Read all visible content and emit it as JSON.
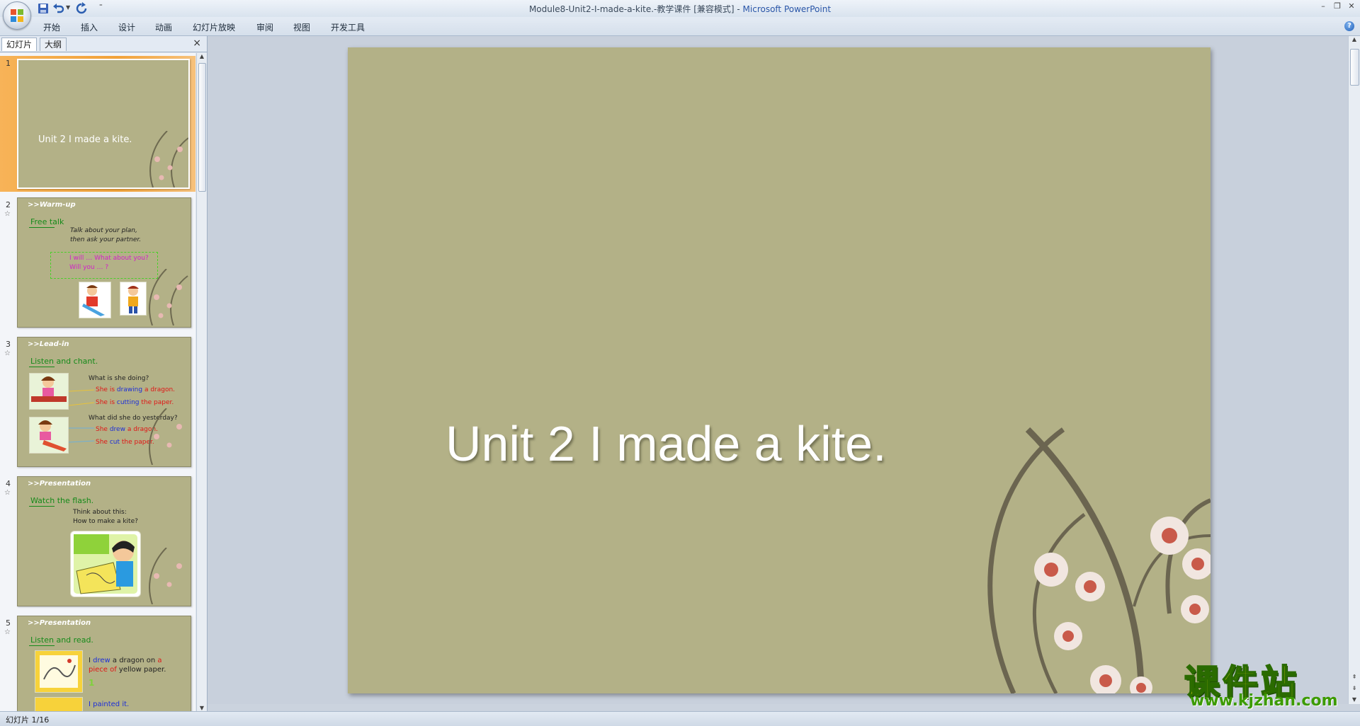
{
  "window": {
    "title_doc": "Module8-Unit2-I-made-a-kite.-教学课件 [兼容模式] - ",
    "title_app": "Microsoft PowerPoint"
  },
  "ribbon": {
    "tabs": [
      "开始",
      "插入",
      "设计",
      "动画",
      "幻灯片放映",
      "审阅",
      "视图",
      "开发工具"
    ]
  },
  "panel": {
    "tab_slides": "幻灯片",
    "tab_outline": "大纲",
    "close": "×"
  },
  "thumbnails": [
    {
      "num": "1",
      "title": "Unit 2 I made a kite."
    },
    {
      "num": "2",
      "section": ">>Warm-up",
      "heading": "Free talk",
      "text1": "Talk about your plan,",
      "text2": "then ask your partner.",
      "box1": "I will … What about you?",
      "box2": "Will you … ?"
    },
    {
      "num": "3",
      "section": ">>Lead-in",
      "heading": "Listen and chant.",
      "q1": "What is she doing?",
      "a1_pre": "She is ",
      "a1_verb": "drawing",
      "a1_post": " a dragon.",
      "a2_pre": "She is ",
      "a2_verb": "cutting",
      "a2_post": " the paper.",
      "q2": "What did she do yesterday?",
      "a3_pre": "She ",
      "a3_verb": "drew",
      "a3_post": " a dragon.",
      "a4_pre": "She ",
      "a4_verb": "cut",
      "a4_post": " the paper."
    },
    {
      "num": "4",
      "section": ">>Presentation",
      "heading": "Watch the flash.",
      "text1": "Think about this:",
      "text2": "How to make a kite?"
    },
    {
      "num": "5",
      "section": ">>Presentation",
      "heading": "Listen and read.",
      "l1_a": "I ",
      "l1_b": "drew",
      "l1_c": " a dragon on ",
      "l1_d": "a",
      "l2_a": "piece of",
      "l2_b": " yellow paper.",
      "mark": "1",
      "l3": "I painted it."
    }
  ],
  "slide": {
    "title": "Unit 2 I made a kite."
  },
  "status": {
    "text": "幻灯片 1/16"
  },
  "watermark": {
    "main": "课件站",
    "url": "www.kjzhan.com"
  }
}
